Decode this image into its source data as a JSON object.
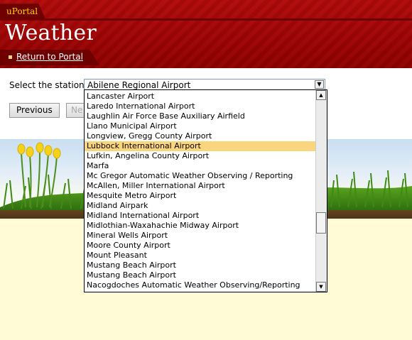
{
  "header": {
    "brand": "uPortal",
    "title": "Weather",
    "nav_link": "Return to Portal"
  },
  "form": {
    "label": "Select the station:",
    "selected_value": "Abilene Regional Airport",
    "previous_label": "Previous",
    "next_label": "Ne"
  },
  "dropdown": {
    "options": [
      "Lancaster Airport",
      "Laredo International Airport",
      "Laughlin Air Force Base Auxiliary Airfield",
      "Llano Municipal Airport",
      "Longview, Gregg County Airport",
      "Lubbock International Airport",
      "Lufkin, Angelina County Airport",
      "Marfa",
      "Mc Gregor Automatic Weather Observing / Reporting",
      "McAllen, Miller International Airport",
      "Mesquite Metro Airport",
      "Midland Airpark",
      "Midland International Airport",
      "Midlothian-Waxahachie Midway Airport",
      "Mineral Wells Airport",
      "Moore County Airport",
      "Mount Pleasant",
      "Mustang Beach Airport",
      "Mustang Beach Airport",
      "Nacogdoches Automatic Weather Observing/Reporting"
    ],
    "highlighted_option": "Lubbock International Airport"
  },
  "icons": {
    "select_arrow": "chevron-down-icon",
    "scroll_up": "arrow-up-icon",
    "scroll_down": "arrow-down-icon"
  },
  "colors": {
    "header_red": "#a40000",
    "brand_yellow": "#ffd400",
    "highlight": "#f9d67e",
    "page_background": "#fffbd6"
  }
}
